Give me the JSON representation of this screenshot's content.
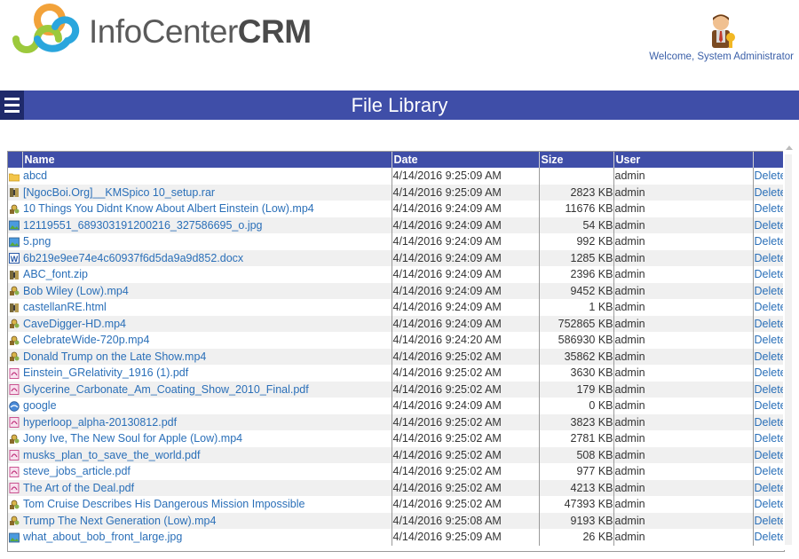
{
  "header": {
    "logo_light": "InfoCenter",
    "logo_bold": "CRM",
    "welcome": "Welcome, System Administrator"
  },
  "titlebar": {
    "title": "File Library"
  },
  "table": {
    "columns": [
      "Name",
      "Date",
      "Size",
      "User"
    ],
    "delete_label": "Delete",
    "rows": [
      {
        "icon": "folder-icon",
        "name": "abcd",
        "date": "4/14/2016 9:25:09 AM",
        "size": "",
        "user": "admin"
      },
      {
        "icon": "archive-icon",
        "name": "[NgocBoi.Org]__KMSpico 10_setup.rar",
        "date": "4/14/2016 9:25:09 AM",
        "size": "2823 KB",
        "user": "admin"
      },
      {
        "icon": "video-icon",
        "name": "10 Things You Didnt Know About Albert Einstein (Low).mp4",
        "date": "4/14/2016 9:24:09 AM",
        "size": "11676 KB",
        "user": "admin"
      },
      {
        "icon": "image-icon",
        "name": "12119551_689303191200216_327586695_o.jpg",
        "date": "4/14/2016 9:24:09 AM",
        "size": "54 KB",
        "user": "admin"
      },
      {
        "icon": "image-icon",
        "name": "5.png",
        "date": "4/14/2016 9:24:09 AM",
        "size": "992 KB",
        "user": "admin"
      },
      {
        "icon": "word-icon",
        "name": "6b219e9ee74e4c60937f6d5da9a9d852.docx",
        "date": "4/14/2016 9:24:09 AM",
        "size": "1285 KB",
        "user": "admin"
      },
      {
        "icon": "archive-icon",
        "name": "ABC_font.zip",
        "date": "4/14/2016 9:24:09 AM",
        "size": "2396 KB",
        "user": "admin"
      },
      {
        "icon": "video-icon",
        "name": "Bob Wiley (Low).mp4",
        "date": "4/14/2016 9:24:09 AM",
        "size": "9452 KB",
        "user": "admin"
      },
      {
        "icon": "archive-icon",
        "name": "castellanRE.html",
        "date": "4/14/2016 9:24:09 AM",
        "size": "1 KB",
        "user": "admin"
      },
      {
        "icon": "video-icon",
        "name": "CaveDigger-HD.mp4",
        "date": "4/14/2016 9:24:09 AM",
        "size": "752865 KB",
        "user": "admin"
      },
      {
        "icon": "video-icon",
        "name": "CelebrateWide-720p.mp4",
        "date": "4/14/2016 9:24:20 AM",
        "size": "586930 KB",
        "user": "admin"
      },
      {
        "icon": "video-icon",
        "name": "Donald Trump on the Late Show.mp4",
        "date": "4/14/2016 9:25:02 AM",
        "size": "35862 KB",
        "user": "admin"
      },
      {
        "icon": "pdf-icon",
        "name": "Einstein_GRelativity_1916 (1).pdf",
        "date": "4/14/2016 9:25:02 AM",
        "size": "3630 KB",
        "user": "admin"
      },
      {
        "icon": "pdf-icon",
        "name": "Glycerine_Carbonate_Am_Coating_Show_2010_Final.pdf",
        "date": "4/14/2016 9:25:02 AM",
        "size": "179 KB",
        "user": "admin"
      },
      {
        "icon": "link-icon",
        "name": "google",
        "date": "4/14/2016 9:24:09 AM",
        "size": "0 KB",
        "user": "admin"
      },
      {
        "icon": "pdf-icon",
        "name": "hyperloop_alpha-20130812.pdf",
        "date": "4/14/2016 9:25:02 AM",
        "size": "3823 KB",
        "user": "admin"
      },
      {
        "icon": "video-icon",
        "name": "Jony Ive, The New Soul for Apple (Low).mp4",
        "date": "4/14/2016 9:25:02 AM",
        "size": "2781 KB",
        "user": "admin"
      },
      {
        "icon": "pdf-icon",
        "name": "musks_plan_to_save_the_world.pdf",
        "date": "4/14/2016 9:25:02 AM",
        "size": "508 KB",
        "user": "admin"
      },
      {
        "icon": "pdf-icon",
        "name": "steve_jobs_article.pdf",
        "date": "4/14/2016 9:25:02 AM",
        "size": "977 KB",
        "user": "admin"
      },
      {
        "icon": "pdf-icon",
        "name": "The Art of the Deal.pdf",
        "date": "4/14/2016 9:25:02 AM",
        "size": "4213 KB",
        "user": "admin"
      },
      {
        "icon": "video-icon",
        "name": "Tom Cruise Describes His Dangerous Mission Impossible",
        "date": "4/14/2016 9:25:02 AM",
        "size": "47393 KB",
        "user": "admin"
      },
      {
        "icon": "video-icon",
        "name": "Trump The Next Generation (Low).mp4",
        "date": "4/14/2016 9:25:08 AM",
        "size": "9193 KB",
        "user": "admin"
      },
      {
        "icon": "image-icon",
        "name": "what_about_bob_front_large.jpg",
        "date": "4/14/2016 9:25:09 AM",
        "size": "26 KB",
        "user": "admin"
      }
    ]
  }
}
